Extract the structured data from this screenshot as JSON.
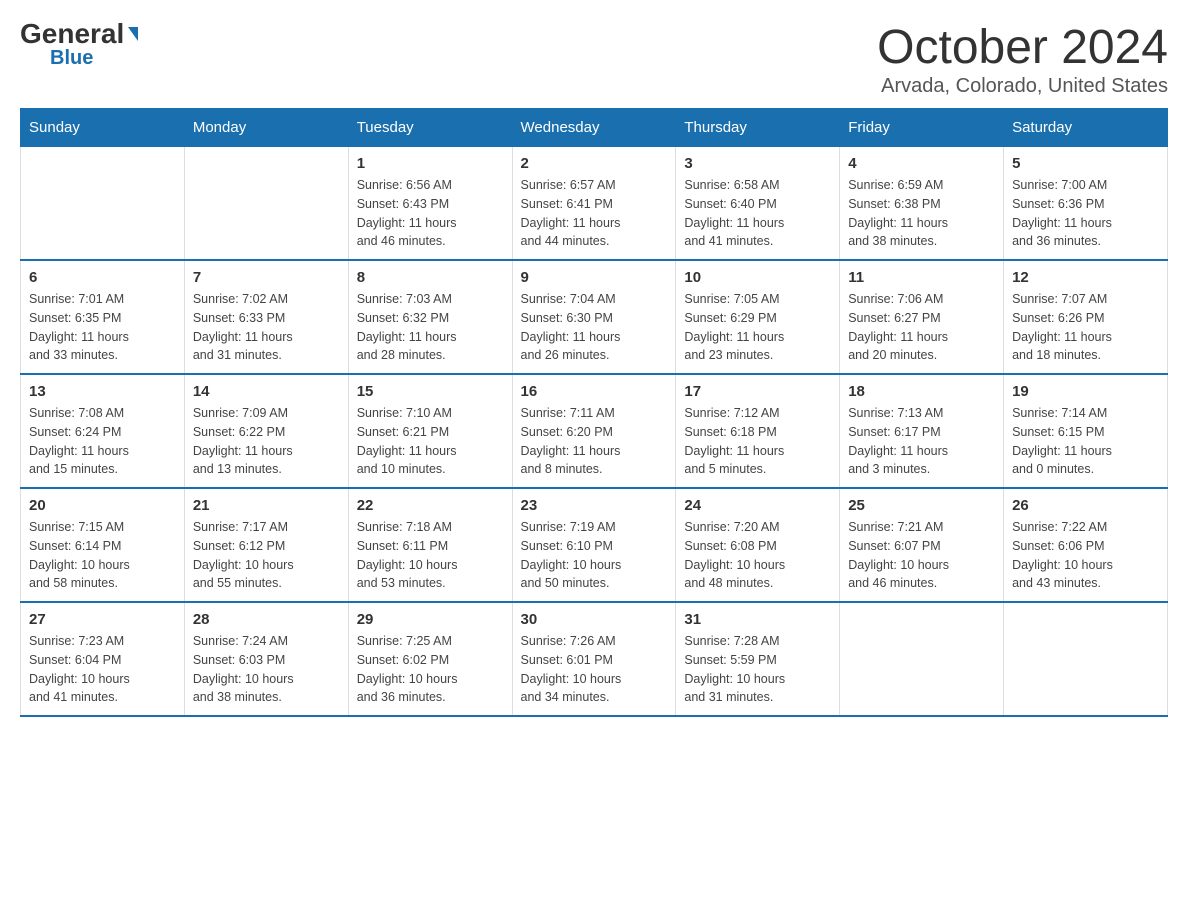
{
  "logo": {
    "general": "General",
    "blue": "Blue"
  },
  "title": "October 2024",
  "location": "Arvada, Colorado, United States",
  "days_of_week": [
    "Sunday",
    "Monday",
    "Tuesday",
    "Wednesday",
    "Thursday",
    "Friday",
    "Saturday"
  ],
  "weeks": [
    [
      {
        "day": "",
        "info": ""
      },
      {
        "day": "",
        "info": ""
      },
      {
        "day": "1",
        "info": "Sunrise: 6:56 AM\nSunset: 6:43 PM\nDaylight: 11 hours\nand 46 minutes."
      },
      {
        "day": "2",
        "info": "Sunrise: 6:57 AM\nSunset: 6:41 PM\nDaylight: 11 hours\nand 44 minutes."
      },
      {
        "day": "3",
        "info": "Sunrise: 6:58 AM\nSunset: 6:40 PM\nDaylight: 11 hours\nand 41 minutes."
      },
      {
        "day": "4",
        "info": "Sunrise: 6:59 AM\nSunset: 6:38 PM\nDaylight: 11 hours\nand 38 minutes."
      },
      {
        "day": "5",
        "info": "Sunrise: 7:00 AM\nSunset: 6:36 PM\nDaylight: 11 hours\nand 36 minutes."
      }
    ],
    [
      {
        "day": "6",
        "info": "Sunrise: 7:01 AM\nSunset: 6:35 PM\nDaylight: 11 hours\nand 33 minutes."
      },
      {
        "day": "7",
        "info": "Sunrise: 7:02 AM\nSunset: 6:33 PM\nDaylight: 11 hours\nand 31 minutes."
      },
      {
        "day": "8",
        "info": "Sunrise: 7:03 AM\nSunset: 6:32 PM\nDaylight: 11 hours\nand 28 minutes."
      },
      {
        "day": "9",
        "info": "Sunrise: 7:04 AM\nSunset: 6:30 PM\nDaylight: 11 hours\nand 26 minutes."
      },
      {
        "day": "10",
        "info": "Sunrise: 7:05 AM\nSunset: 6:29 PM\nDaylight: 11 hours\nand 23 minutes."
      },
      {
        "day": "11",
        "info": "Sunrise: 7:06 AM\nSunset: 6:27 PM\nDaylight: 11 hours\nand 20 minutes."
      },
      {
        "day": "12",
        "info": "Sunrise: 7:07 AM\nSunset: 6:26 PM\nDaylight: 11 hours\nand 18 minutes."
      }
    ],
    [
      {
        "day": "13",
        "info": "Sunrise: 7:08 AM\nSunset: 6:24 PM\nDaylight: 11 hours\nand 15 minutes."
      },
      {
        "day": "14",
        "info": "Sunrise: 7:09 AM\nSunset: 6:22 PM\nDaylight: 11 hours\nand 13 minutes."
      },
      {
        "day": "15",
        "info": "Sunrise: 7:10 AM\nSunset: 6:21 PM\nDaylight: 11 hours\nand 10 minutes."
      },
      {
        "day": "16",
        "info": "Sunrise: 7:11 AM\nSunset: 6:20 PM\nDaylight: 11 hours\nand 8 minutes."
      },
      {
        "day": "17",
        "info": "Sunrise: 7:12 AM\nSunset: 6:18 PM\nDaylight: 11 hours\nand 5 minutes."
      },
      {
        "day": "18",
        "info": "Sunrise: 7:13 AM\nSunset: 6:17 PM\nDaylight: 11 hours\nand 3 minutes."
      },
      {
        "day": "19",
        "info": "Sunrise: 7:14 AM\nSunset: 6:15 PM\nDaylight: 11 hours\nand 0 minutes."
      }
    ],
    [
      {
        "day": "20",
        "info": "Sunrise: 7:15 AM\nSunset: 6:14 PM\nDaylight: 10 hours\nand 58 minutes."
      },
      {
        "day": "21",
        "info": "Sunrise: 7:17 AM\nSunset: 6:12 PM\nDaylight: 10 hours\nand 55 minutes."
      },
      {
        "day": "22",
        "info": "Sunrise: 7:18 AM\nSunset: 6:11 PM\nDaylight: 10 hours\nand 53 minutes."
      },
      {
        "day": "23",
        "info": "Sunrise: 7:19 AM\nSunset: 6:10 PM\nDaylight: 10 hours\nand 50 minutes."
      },
      {
        "day": "24",
        "info": "Sunrise: 7:20 AM\nSunset: 6:08 PM\nDaylight: 10 hours\nand 48 minutes."
      },
      {
        "day": "25",
        "info": "Sunrise: 7:21 AM\nSunset: 6:07 PM\nDaylight: 10 hours\nand 46 minutes."
      },
      {
        "day": "26",
        "info": "Sunrise: 7:22 AM\nSunset: 6:06 PM\nDaylight: 10 hours\nand 43 minutes."
      }
    ],
    [
      {
        "day": "27",
        "info": "Sunrise: 7:23 AM\nSunset: 6:04 PM\nDaylight: 10 hours\nand 41 minutes."
      },
      {
        "day": "28",
        "info": "Sunrise: 7:24 AM\nSunset: 6:03 PM\nDaylight: 10 hours\nand 38 minutes."
      },
      {
        "day": "29",
        "info": "Sunrise: 7:25 AM\nSunset: 6:02 PM\nDaylight: 10 hours\nand 36 minutes."
      },
      {
        "day": "30",
        "info": "Sunrise: 7:26 AM\nSunset: 6:01 PM\nDaylight: 10 hours\nand 34 minutes."
      },
      {
        "day": "31",
        "info": "Sunrise: 7:28 AM\nSunset: 5:59 PM\nDaylight: 10 hours\nand 31 minutes."
      },
      {
        "day": "",
        "info": ""
      },
      {
        "day": "",
        "info": ""
      }
    ]
  ]
}
